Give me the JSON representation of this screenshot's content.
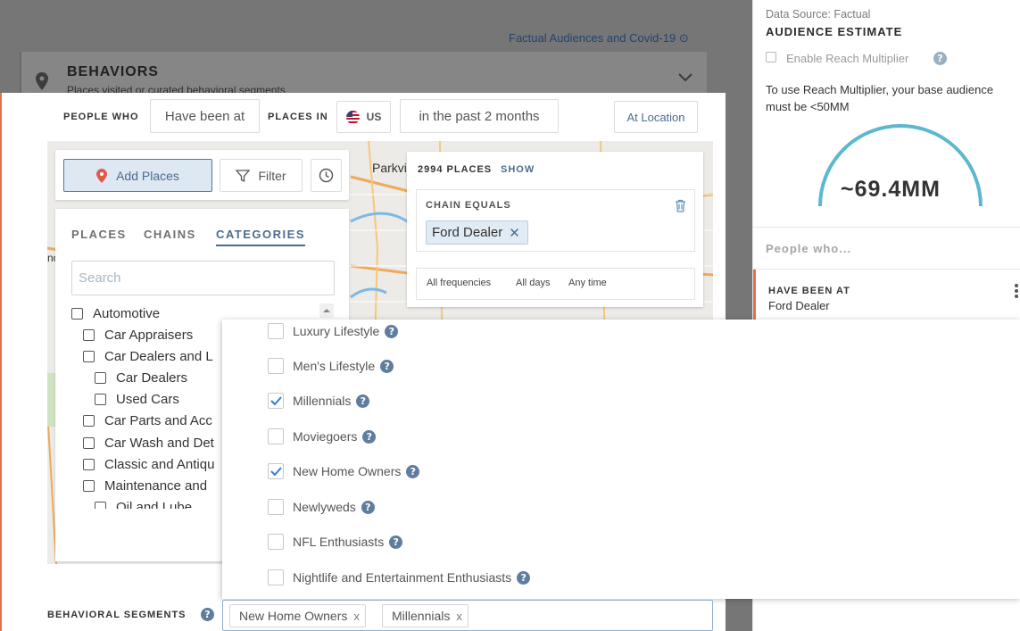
{
  "background": {
    "link": "Factual Audiences and Covid-19",
    "card_title": "BEHAVIORS",
    "card_subtitle": "Places visited or curated behavioral segments"
  },
  "right_panel": {
    "source": "Data Source: Factual",
    "title": "AUDIENCE ESTIMATE",
    "reach_label": "Enable Reach Multiplier",
    "reach_checked": false,
    "note": "To use Reach Multiplier, your base audience must be <50MM",
    "estimate": "~69.4MM",
    "people_label": "People who...",
    "item": {
      "title": "HAVE BEEN AT",
      "value": "Ford Dealer"
    },
    "accent": "#5bb8cf"
  },
  "query": {
    "people_who_label": "PEOPLE WHO",
    "been_at": "Have been at",
    "places_in_label": "PLACES IN",
    "country": "US",
    "timeframe": "in the past 2 months",
    "location": "At Location"
  },
  "map": {
    "labels": [
      "Parkvi",
      "no"
    ]
  },
  "toolbar": {
    "add_places": "Add Places",
    "filter": "Filter"
  },
  "categories_panel": {
    "tabs": [
      "PLACES",
      "CHAINS",
      "CATEGORIES"
    ],
    "active_tab": "CATEGORIES",
    "search_placeholder": "Search",
    "items": [
      {
        "label": "Automotive",
        "level": 0
      },
      {
        "label": "Car Appraisers",
        "level": 1
      },
      {
        "label": "Car Dealers and L",
        "level": 1
      },
      {
        "label": "Car Dealers",
        "level": 2
      },
      {
        "label": "Used Cars",
        "level": 2
      },
      {
        "label": "Car Parts and Acc",
        "level": 1
      },
      {
        "label": "Car Wash and Det",
        "level": 1
      },
      {
        "label": "Classic and Antiqu",
        "level": 1
      },
      {
        "label": "Maintenance and",
        "level": 1
      },
      {
        "label": "Oil and Lube",
        "level": 2
      }
    ]
  },
  "places_box": {
    "count": "2994 PLACES",
    "show": "SHOW",
    "chain_title": "CHAIN EQUALS",
    "chain_value": "Ford Dealer",
    "frequencies": [
      "All frequencies",
      "All days",
      "Any time"
    ]
  },
  "dropdown": {
    "options": [
      {
        "label": "Luxury Lifestyle",
        "checked": false
      },
      {
        "label": "Men's Lifestyle",
        "checked": false
      },
      {
        "label": "Millennials",
        "checked": true
      },
      {
        "label": "Moviegoers",
        "checked": false
      },
      {
        "label": "New Home Owners",
        "checked": true
      },
      {
        "label": "Newlyweds",
        "checked": false
      },
      {
        "label": "NFL Enthusiasts",
        "checked": false
      },
      {
        "label": "Nightlife and Entertainment Enthusiasts",
        "checked": false
      }
    ],
    "check_color": "#2a7de1"
  },
  "behavioral_segments": {
    "label": "BEHAVIORAL SEGMENTS",
    "tags": [
      "New Home Owners",
      "Millennials"
    ]
  }
}
